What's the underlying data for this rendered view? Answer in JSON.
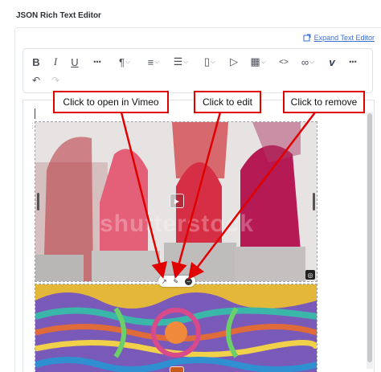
{
  "panel": {
    "title": "JSON Rich Text Editor"
  },
  "expand": {
    "icon": "expand-icon",
    "label": "Expand Text Editor"
  },
  "toolbar": {
    "row1": [
      {
        "icon": "bold-icon",
        "glyph": "B"
      },
      {
        "icon": "italic-icon",
        "glyph": "I"
      },
      {
        "icon": "underline-icon",
        "glyph": "U"
      },
      {
        "icon": "more-icon",
        "glyph": "•••"
      },
      {
        "icon": "paragraph-icon",
        "glyph": "¶"
      },
      {
        "icon": "align-icon",
        "glyph": "≡"
      },
      {
        "icon": "list-icon",
        "glyph": "☰"
      },
      {
        "icon": "file-icon",
        "glyph": "▯"
      },
      {
        "icon": "video-icon",
        "glyph": "▷"
      },
      {
        "icon": "table-icon",
        "glyph": "▦"
      },
      {
        "icon": "code-icon",
        "glyph": "<>"
      },
      {
        "icon": "link-icon",
        "glyph": "∞"
      },
      {
        "icon": "vimeo-icon",
        "glyph": "v"
      },
      {
        "icon": "more-icon",
        "glyph": "•••"
      }
    ],
    "row2": [
      {
        "icon": "undo-icon",
        "glyph": "↶"
      },
      {
        "icon": "redo-icon",
        "glyph": "↷"
      }
    ]
  },
  "editor": {
    "watermark": "shutterstock",
    "actions": [
      {
        "icon": "open-external-icon",
        "glyph": "↗"
      },
      {
        "icon": "edit-pencil-icon",
        "glyph": "✎"
      },
      {
        "icon": "remove-icon",
        "glyph": "−"
      }
    ],
    "play_glyph": "▶",
    "corner_glyph": "◎"
  },
  "callouts": {
    "vimeo": "Click to open in Vimeo",
    "edit": "Click to edit",
    "remove": "Click to remove"
  },
  "colors": {
    "accent": "#3b6fd4",
    "annotation": "#e00000"
  }
}
